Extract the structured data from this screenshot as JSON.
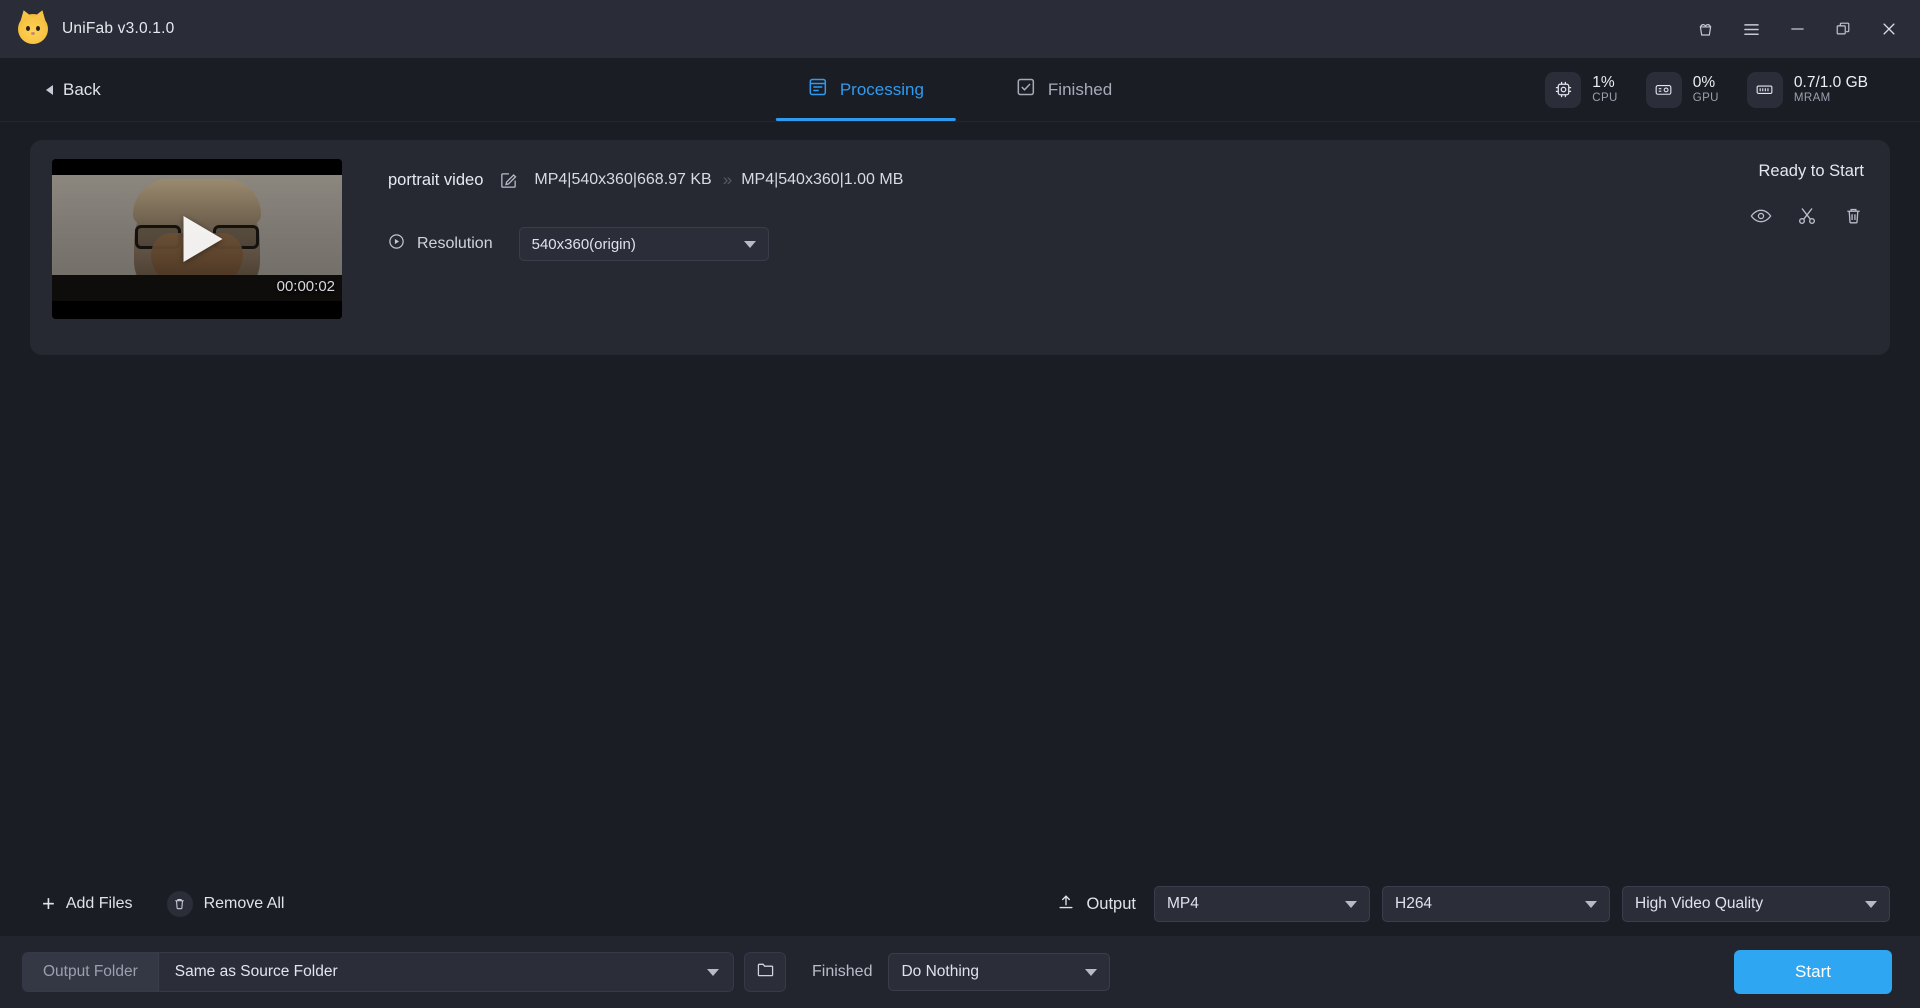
{
  "titlebar": {
    "app_title": "UniFab v3.0.1.0",
    "logo_icon": "cat-logo-icon",
    "controls": [
      {
        "name": "gift-icon",
        "label": ""
      },
      {
        "name": "menu-icon",
        "label": ""
      },
      {
        "name": "minimize-icon",
        "label": ""
      },
      {
        "name": "maximize-icon",
        "label": ""
      },
      {
        "name": "close-icon",
        "label": ""
      }
    ]
  },
  "navbar": {
    "back_label": "Back",
    "back_icon": "chevron-left-icon",
    "tabs": [
      {
        "label": "Processing",
        "icon": "list-document-icon",
        "active": true
      },
      {
        "label": "Finished",
        "icon": "checkbox-icon",
        "active": false
      }
    ],
    "stats": [
      {
        "icon": "cpu-chip-icon",
        "value": "1%",
        "label": "CPU"
      },
      {
        "icon": "gpu-card-icon",
        "value": "0%",
        "label": "GPU"
      },
      {
        "icon": "ram-stick-icon",
        "value": "0.7/1.0 GB",
        "label": "MRAM"
      }
    ]
  },
  "task": {
    "thumbnail": {
      "duration": "00:00:02",
      "play_icon": "play-triangle-icon"
    },
    "file_name": "portrait video",
    "edit_icon": "edit-pencil-icon",
    "source_meta": "MP4|540x360|668.97 KB",
    "arrow_icon": "double-chevron-right-icon",
    "target_meta": "MP4|540x360|1.00 MB",
    "resolution_label": "Resolution",
    "resolution_icon": "play-circle-icon",
    "resolution_value": "540x360(origin)",
    "status": "Ready to Start",
    "actions": [
      {
        "icon": "eye-preview-icon",
        "label": ""
      },
      {
        "icon": "scissors-trim-icon",
        "label": ""
      },
      {
        "icon": "trash-delete-icon",
        "label": ""
      }
    ]
  },
  "toolbar": {
    "add_files_label": "Add Files",
    "add_files_icon": "plus-icon",
    "remove_all_label": "Remove All",
    "remove_all_icon": "trash-icon",
    "output_label": "Output",
    "output_icon": "upload-icon",
    "format_value": "MP4",
    "codec_value": "H264",
    "quality_value": "High Video Quality"
  },
  "footer": {
    "output_folder_label": "Output Folder",
    "output_folder_value": "Same as Source Folder",
    "browse_icon": "folder-icon",
    "finished_label": "Finished",
    "finished_value": "Do Nothing",
    "start_label": "Start"
  },
  "colors": {
    "accent": "#2fa6f2",
    "titlebar_bg": "#2a2d38",
    "page_bg": "#1b1d24",
    "card_bg": "#262932",
    "footer_bg": "#22252e"
  }
}
